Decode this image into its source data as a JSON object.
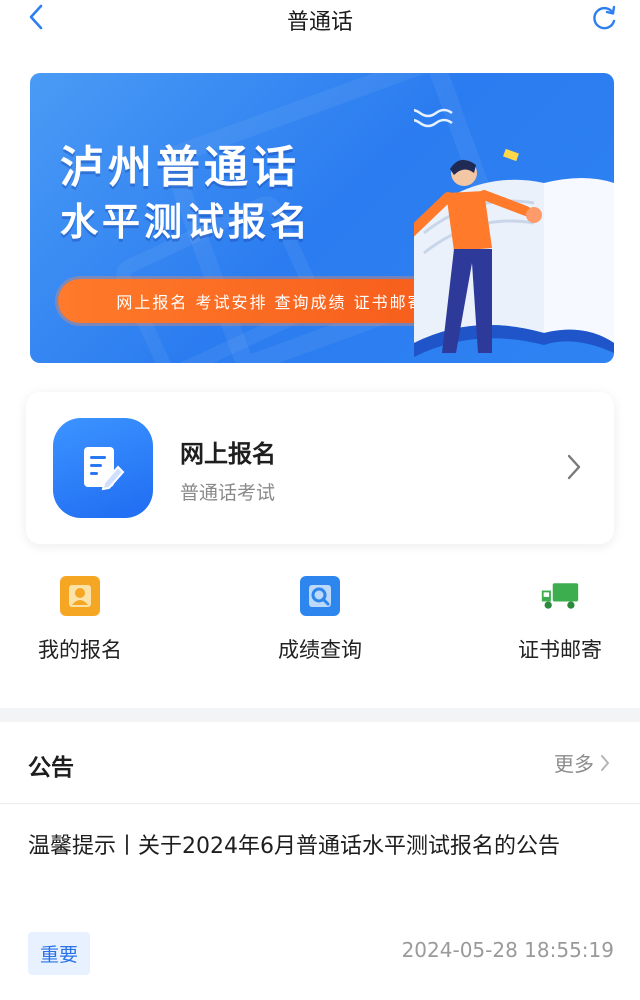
{
  "nav": {
    "title": "普通话"
  },
  "banner": {
    "title_line1": "泸州普通话",
    "title_line2": "水平测试报名",
    "pill_text": "网上报名 考试安排 查询成绩 证书邮寄"
  },
  "card": {
    "title": "网上报名",
    "subtitle": "普通话考试"
  },
  "quick": [
    {
      "label": "我的报名",
      "icon": "person-icon",
      "color": "#f5a623"
    },
    {
      "label": "成绩查询",
      "icon": "search-doc-icon",
      "color": "#2d86ee"
    },
    {
      "label": "证书邮寄",
      "icon": "truck-icon",
      "color": "#3cae4e"
    }
  ],
  "notice": {
    "title": "公告",
    "more": "更多",
    "item": {
      "text": "温馨提示丨关于2024年6月普通话水平测试报名的公告",
      "tag": "重要",
      "time": "2024-05-28 18:55:19"
    }
  },
  "colors": {
    "accent": "#2b7cf0",
    "orange": "#f55a1a"
  }
}
